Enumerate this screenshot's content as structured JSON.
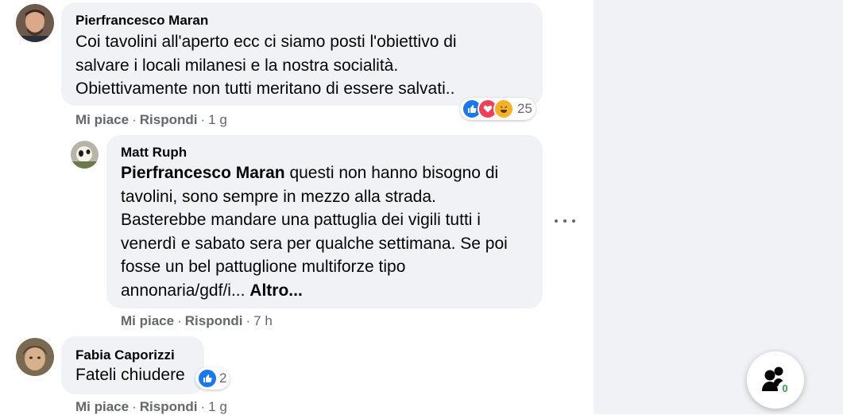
{
  "comments": [
    {
      "author": "Pierfrancesco Maran",
      "lines": [
        "Coi tavolini all'aperto ecc ci siamo posti l'obiettivo di",
        "salvare i locali milanesi e la nostra socialità.",
        "Obiettivamente non tutti meritano di essere salvati.."
      ],
      "like": "Mi piace",
      "reply": "Rispondi",
      "time": "1 g",
      "reaction_count": "25",
      "reaction_icons": [
        "like-icon",
        "love-icon",
        "haha-icon"
      ]
    },
    {
      "author": "Matt Ruph",
      "mention": "Pierfrancesco Maran",
      "first_line_rest": " questi non hanno bisogno di",
      "lines": [
        "tavolini, sono sempre in mezzo alla strada.",
        "Basterebbe mandare una pattuglia dei vigili tutti i",
        "venerdì e sabato sera per qualche settimana. Se poi",
        "fosse un bel pattuglione multiforze tipo"
      ],
      "last_line": "annonaria/gdf/i... ",
      "see_more": "Altro...",
      "like": "Mi piace",
      "reply": "Rispondi",
      "time": "7 h"
    },
    {
      "author": "Fabia Caporizzi",
      "lines": [
        "Fateli chiudere"
      ],
      "like": "Mi piace",
      "reply": "Rispondi",
      "time": "1 g",
      "reaction_count": "2",
      "reaction_icons": [
        "like-icon"
      ]
    }
  ],
  "separator": "·",
  "contacts_fab": {
    "icon": "people-icon",
    "badge": "0"
  },
  "colors": {
    "like_blue": "#1877f2",
    "love_red": "#f33e58",
    "haha_yellow": "#f7b125",
    "bubble_bg": "#f0f2f5",
    "meta_gray": "#65676b",
    "online_green": "#31a24c"
  }
}
